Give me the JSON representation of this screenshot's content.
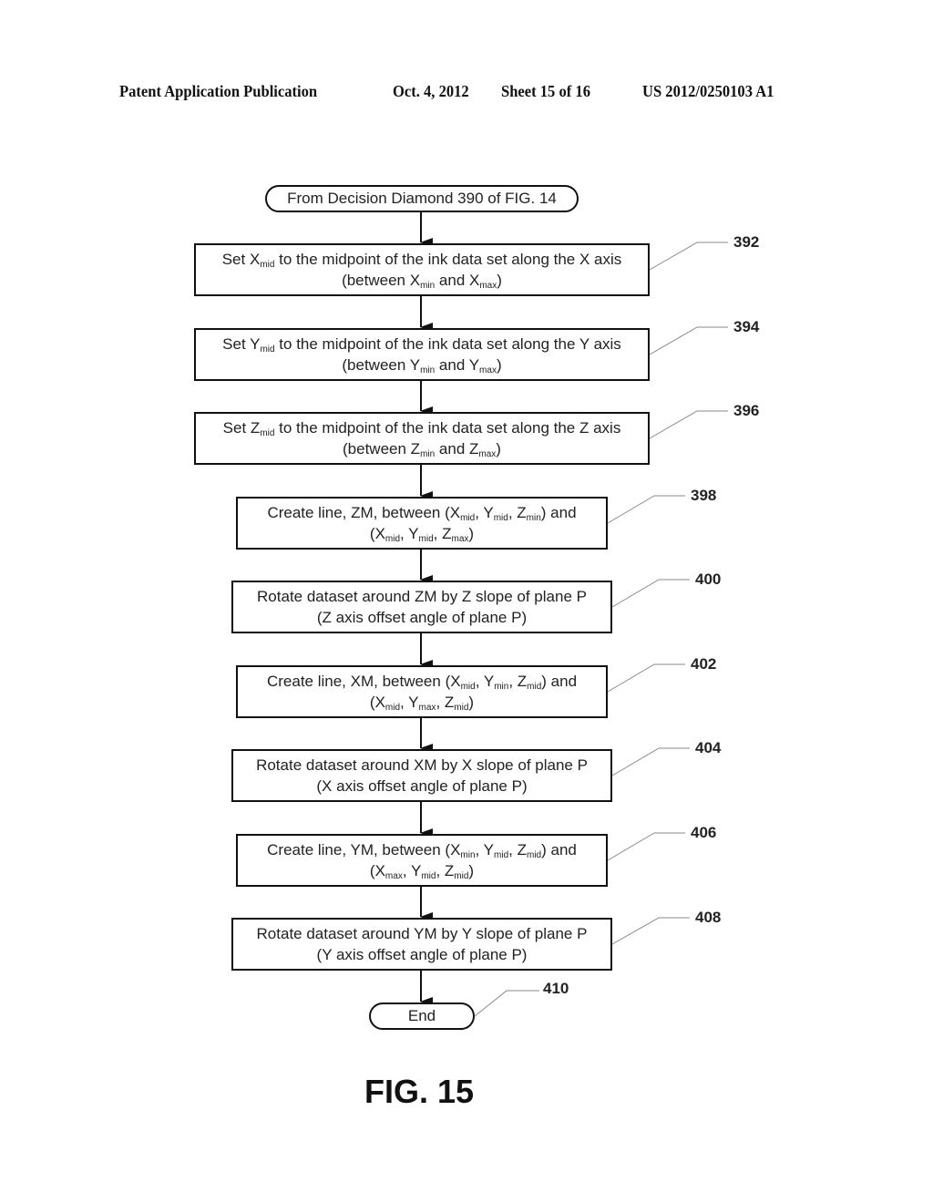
{
  "header": {
    "publication": "Patent Application Publication",
    "date": "Oct. 4, 2012",
    "sheet": "Sheet 15 of 16",
    "number": "US 2012/0250103 A1"
  },
  "start": {
    "label": "From Decision Diamond 390 of FIG. 14"
  },
  "steps": [
    {
      "ref": "392",
      "line1": [
        "Set X",
        "mid",
        " to the midpoint of the ink data set along the X axis"
      ],
      "line2": [
        "(between X",
        "min",
        " and X",
        "max",
        ")"
      ]
    },
    {
      "ref": "394",
      "line1": [
        "Set Y",
        "mid",
        " to the midpoint of the ink data set along the Y axis"
      ],
      "line2": [
        "(between Y",
        "min",
        " and Y",
        "max",
        ")"
      ]
    },
    {
      "ref": "396",
      "line1": [
        "Set Z",
        "mid",
        " to the midpoint of the ink data set along the Z axis"
      ],
      "line2": [
        "(between Z",
        "min",
        " and Z",
        "max",
        ")"
      ]
    },
    {
      "ref": "398",
      "line1": [
        "Create line, ZM, between (X",
        "mid",
        ", Y",
        "mid",
        ", Z",
        "min",
        ") and"
      ],
      "line2": [
        "(X",
        "mid",
        ", Y",
        "mid",
        ", Z",
        "max",
        ")"
      ]
    },
    {
      "ref": "400",
      "line1": [
        "Rotate dataset around ZM by Z slope of plane P"
      ],
      "line2": [
        "(Z axis offset angle of plane P)"
      ]
    },
    {
      "ref": "402",
      "line1": [
        "Create line, XM, between (X",
        "mid",
        ", Y",
        "min",
        ", Z",
        "mid",
        ") and"
      ],
      "line2": [
        "(X",
        "mid",
        ", Y",
        "max",
        ", Z",
        "mid",
        ")"
      ]
    },
    {
      "ref": "404",
      "line1": [
        "Rotate dataset around XM by X slope of plane P"
      ],
      "line2": [
        "(X axis offset angle of plane P)"
      ]
    },
    {
      "ref": "406",
      "line1": [
        "Create line, YM, between (X",
        "min",
        ", Y",
        "mid",
        ", Z",
        "mid",
        ") and"
      ],
      "line2": [
        "(X",
        "max",
        ", Y",
        "mid",
        ", Z",
        "mid",
        ")"
      ]
    },
    {
      "ref": "408",
      "line1": [
        "Rotate dataset around YM by Y slope of plane P"
      ],
      "line2": [
        "(Y axis offset angle of plane P)"
      ]
    }
  ],
  "end": {
    "label": "End",
    "ref": "410"
  },
  "figure_label": "FIG. 15"
}
